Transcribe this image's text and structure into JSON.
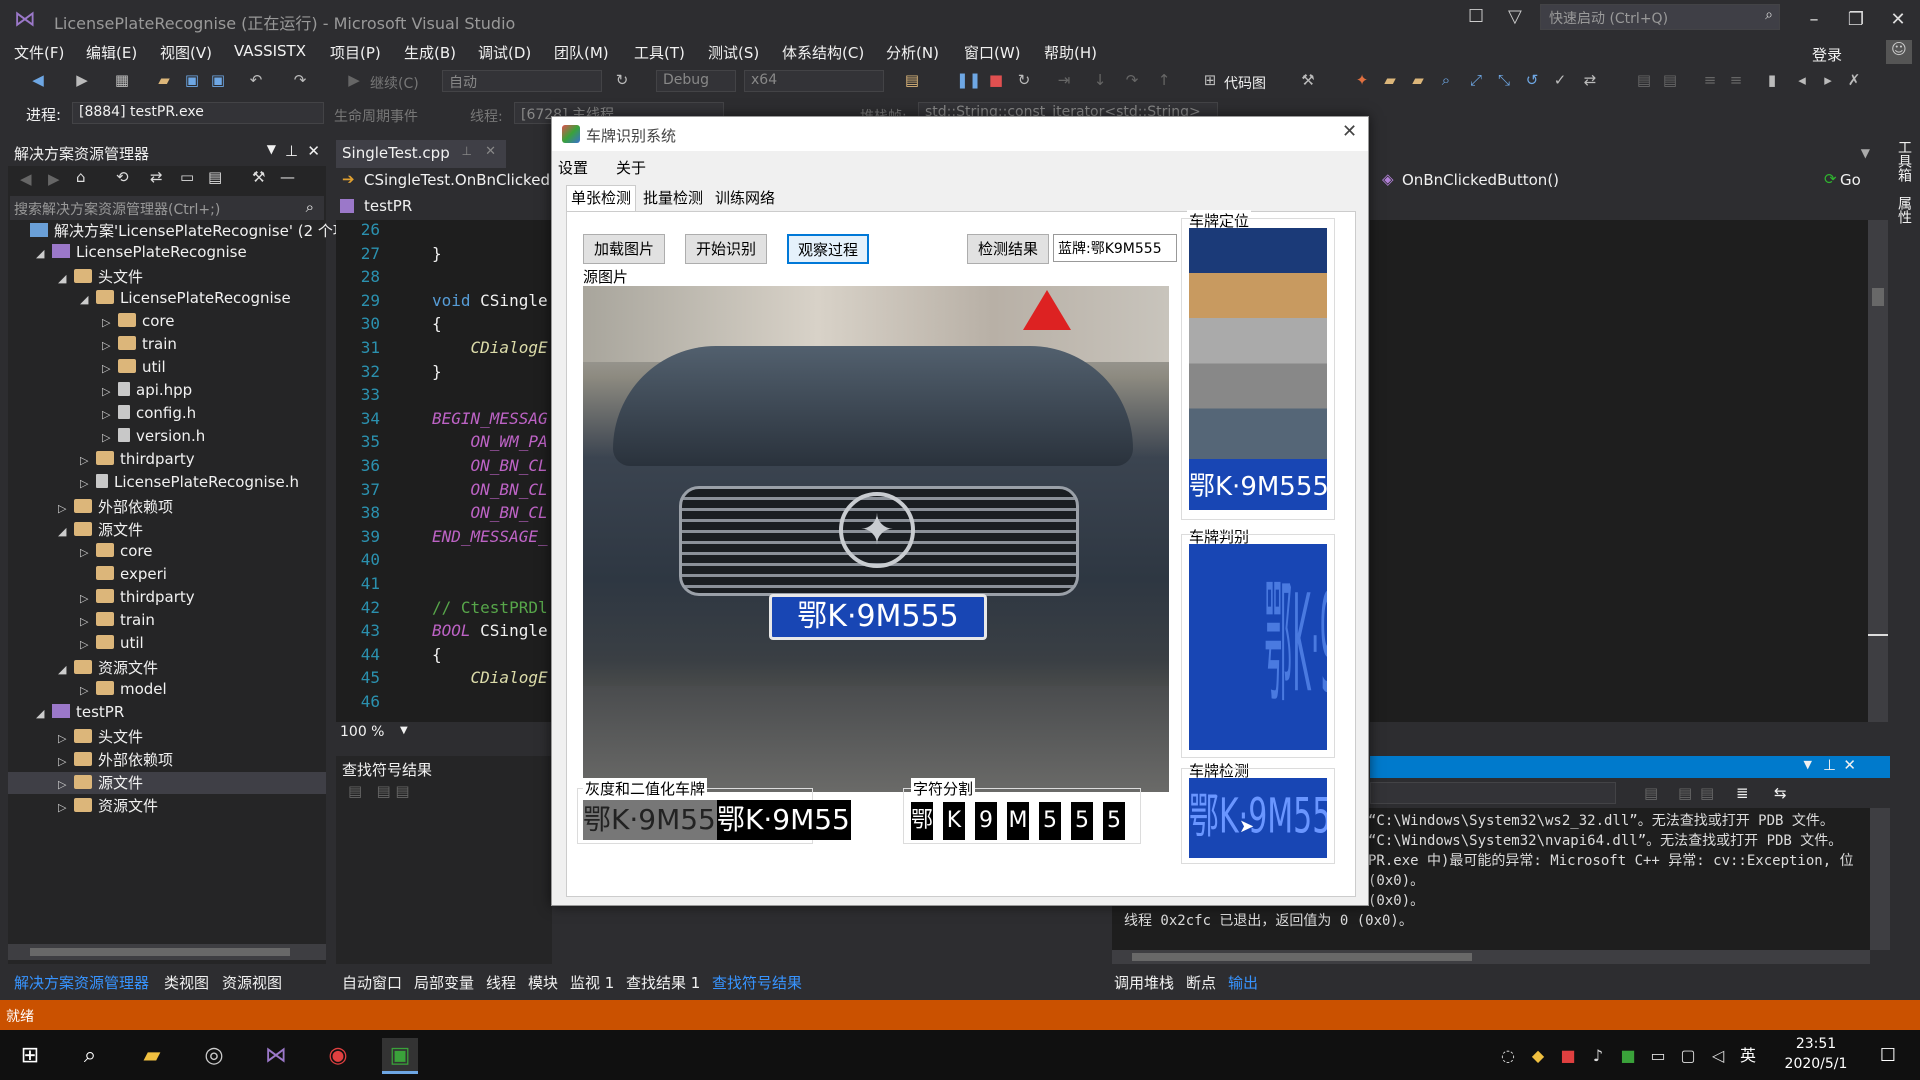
{
  "window": {
    "title": "LicensePlateRecognise (正在运行) - Microsoft Visual Studio",
    "quick_launch_placeholder": "快速启动 (Ctrl+Q)",
    "login": "登录"
  },
  "menu": [
    "文件(F)",
    "编辑(E)",
    "视图(V)",
    "VASSISTX",
    "项目(P)",
    "生成(B)",
    "调试(D)",
    "团队(M)",
    "工具(T)",
    "测试(S)",
    "体系结构(C)",
    "分析(N)",
    "窗口(W)",
    "帮助(H)"
  ],
  "toolbar": {
    "continue_label": "继续(C)",
    "config_auto": "自动",
    "config": "Debug",
    "platform": "x64",
    "codemap": "代码图",
    "process_label": "进程:",
    "process_value": "[8884] testPR.exe",
    "lifecycle": "生命周期事件",
    "thread_label": "线程:",
    "thread_value": "[6728] 主线程",
    "stack_label": "堆栈帧:",
    "stack_value": "std::String::const_iterator<std::String>"
  },
  "solution_explorer": {
    "title": "解决方案资源管理器",
    "search_placeholder": "搜索解决方案资源管理器(Ctrl+;)",
    "items": [
      {
        "label": "解决方案'LicensePlateRecognise' (2 个项目)",
        "indent": 0,
        "type": "sol",
        "arrow": ""
      },
      {
        "label": "LicensePlateRecognise",
        "indent": 1,
        "type": "proj",
        "arrow": "◢"
      },
      {
        "label": "头文件",
        "indent": 2,
        "type": "folder",
        "arrow": "◢"
      },
      {
        "label": "LicensePlateRecognise",
        "indent": 3,
        "type": "folder",
        "arrow": "◢"
      },
      {
        "label": "core",
        "indent": 4,
        "type": "folder",
        "arrow": "▷"
      },
      {
        "label": "train",
        "indent": 4,
        "type": "folder",
        "arrow": "▷"
      },
      {
        "label": "util",
        "indent": 4,
        "type": "folder",
        "arrow": "▷"
      },
      {
        "label": "api.hpp",
        "indent": 4,
        "type": "file",
        "arrow": "▷"
      },
      {
        "label": "config.h",
        "indent": 4,
        "type": "file",
        "arrow": "▷"
      },
      {
        "label": "version.h",
        "indent": 4,
        "type": "file",
        "arrow": "▷"
      },
      {
        "label": "thirdparty",
        "indent": 3,
        "type": "folder",
        "arrow": "▷"
      },
      {
        "label": "LicensePlateRecognise.h",
        "indent": 3,
        "type": "file",
        "arrow": "▷"
      },
      {
        "label": "外部依赖项",
        "indent": 2,
        "type": "folder",
        "arrow": "▷"
      },
      {
        "label": "源文件",
        "indent": 2,
        "type": "folder",
        "arrow": "◢"
      },
      {
        "label": "core",
        "indent": 3,
        "type": "folder",
        "arrow": "▷"
      },
      {
        "label": "experi",
        "indent": 3,
        "type": "folder",
        "arrow": ""
      },
      {
        "label": "thirdparty",
        "indent": 3,
        "type": "folder",
        "arrow": "▷"
      },
      {
        "label": "train",
        "indent": 3,
        "type": "folder",
        "arrow": "▷"
      },
      {
        "label": "util",
        "indent": 3,
        "type": "folder",
        "arrow": "▷"
      },
      {
        "label": "资源文件",
        "indent": 2,
        "type": "folder",
        "arrow": "◢"
      },
      {
        "label": "model",
        "indent": 3,
        "type": "folder",
        "arrow": "▷"
      },
      {
        "label": "testPR",
        "indent": 1,
        "type": "proj",
        "arrow": "◢"
      },
      {
        "label": "头文件",
        "indent": 2,
        "type": "folder",
        "arrow": "▷"
      },
      {
        "label": "外部依赖项",
        "indent": 2,
        "type": "folder",
        "arrow": "▷"
      },
      {
        "label": "源文件",
        "indent": 2,
        "type": "folder",
        "arrow": "▷"
      },
      {
        "label": "资源文件",
        "indent": 2,
        "type": "folder",
        "arrow": "▷"
      }
    ]
  },
  "editor": {
    "tab": "SingleTest.cpp",
    "nav_left": "CSingleTest.OnBnClicked",
    "nav_right": "OnBnClickedButton()",
    "project": "testPR",
    "zoom": "100 %",
    "lines": [
      {
        "n": "26",
        "html": ""
      },
      {
        "n": "27",
        "html": "}"
      },
      {
        "n": "28",
        "html": ""
      },
      {
        "n": "29",
        "html": "<span class=\"kw\">void</span> CSingle"
      },
      {
        "n": "30",
        "html": "{"
      },
      {
        "n": "31",
        "html": "    <span class=\"fn\">CDialogE</span>"
      },
      {
        "n": "32",
        "html": "}"
      },
      {
        "n": "33",
        "html": ""
      },
      {
        "n": "34",
        "html": "<span class=\"mac\">BEGIN_MESSAG</span>"
      },
      {
        "n": "35",
        "html": "    <span class=\"mac\">ON_WM_PA</span>"
      },
      {
        "n": "36",
        "html": "    <span class=\"mac\">ON_BN_CL</span>"
      },
      {
        "n": "37",
        "html": "    <span class=\"mac\">ON_BN_CL</span>"
      },
      {
        "n": "38",
        "html": "    <span class=\"mac\">ON_BN_CL</span>"
      },
      {
        "n": "39",
        "html": "<span class=\"mac\">END_MESSAGE_</span>"
      },
      {
        "n": "40",
        "html": ""
      },
      {
        "n": "41",
        "html": ""
      },
      {
        "n": "42",
        "html": "<span class=\"cmt\">// CtestPRDl</span>"
      },
      {
        "n": "43",
        "html": "<span class=\"mac\">BOOL</span> CSingle"
      },
      {
        "n": "44",
        "html": "{"
      },
      {
        "n": "45",
        "html": "    <span class=\"fn\">CDialogE</span>"
      },
      {
        "n": "46",
        "html": ""
      }
    ]
  },
  "find_symbol": {
    "title": "查找符号结果"
  },
  "output": {
    "lines": [
      "“C:\\Windows\\System32\\ws2_32.dll”。无法查找或打开 PDB 文件。",
      "“C:\\Windows\\System32\\nvapi64.dll”。无法查找或打开 PDB 文件。",
      "PR.exe 中)最可能的异常: Microsoft C++ 异常: cv::Exception, 位",
      "(0x0)。",
      "(0x0)。",
      "线程 0x2cfc 已退出，返回值为 0 (0x0)。"
    ]
  },
  "bottom_tabs_left": [
    "解决方案资源管理器",
    "类视图",
    "资源视图"
  ],
  "bottom_tabs_mid": [
    "自动窗口",
    "局部变量",
    "线程",
    "模块",
    "监视 1",
    "查找结果 1",
    "查找符号结果"
  ],
  "bottom_tabs_right": [
    "调用堆栈",
    "断点",
    "输出"
  ],
  "status": "就绪",
  "side_tabs": [
    "工具箱",
    "属性"
  ],
  "dialog": {
    "title": "车牌识别系统",
    "menu": [
      "设置",
      "关于"
    ],
    "tabs": [
      "单张检测",
      "批量检测",
      "训练网络"
    ],
    "buttons": {
      "load": "加载图片",
      "start": "开始识别",
      "observe": "观察过程",
      "result": "检测结果"
    },
    "result_value": "蓝牌:鄂K9M555",
    "groups": {
      "source": "源图片",
      "locate": "车牌定位",
      "judge": "车牌判别",
      "detect": "车牌检测",
      "gray": "灰度和二值化车牌",
      "segment": "字符分割"
    },
    "plate_text": "鄂K·9M555",
    "plate_short": "K·9M555",
    "chars": [
      "鄂",
      "K",
      "9",
      "M",
      "5",
      "5",
      "5"
    ]
  },
  "taskbar": {
    "time": "23:51",
    "date": "2020/5/1",
    "ime": "英"
  }
}
